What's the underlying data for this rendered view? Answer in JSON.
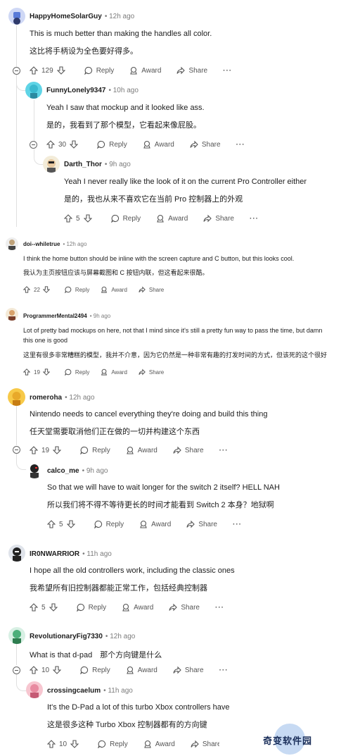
{
  "comments": [
    {
      "user": "HappyHomeSolarGuy",
      "time": "12h ago",
      "en": "This is much better than making the handles all color.",
      "zh": "这比将手柄设为全色要好得多。",
      "votes": "129"
    },
    {
      "user": "FunnyLonely9347",
      "time": "10h ago",
      "en": "Yeah I saw that mockup and it looked like ass.",
      "zh": "是的，我看到了那个模型，它看起来像屁股。",
      "votes": "30"
    },
    {
      "user": "Darth_Thor",
      "time": "9h ago",
      "en": "Yeah I never really like the look of it on the current Pro Controller either",
      "zh": "是的，我也从来不喜欢它在当前 Pro 控制器上的外观",
      "votes": "5"
    },
    {
      "user": "doi--whiletrue",
      "time": "12h ago",
      "en": "I think the home button should be inline with the screen capture and C button, but this looks cool.",
      "zh": "我认为主页按钮应该与屏幕截图和 C 按钮内联，但这看起来很酷。",
      "votes": "22"
    },
    {
      "user": "ProgrammerMental2494",
      "time": "9h ago",
      "en": "Lot of pretty bad mockups on here, not that I mind since it's still a pretty fun way to pass the time, but damn",
      "en2": "this one is good",
      "zh": "这里有很多非常糟糕的模型，我并不介意，因为它仍然是一种非常有趣的打发时间的方式，但该死的这个很好",
      "votes": "19"
    },
    {
      "user": "romeroha",
      "time": "12h ago",
      "en": "Nintendo needs to cancel everything they're doing and build this thing",
      "zh": "任天堂需要取消他们正在做的一切并构建这个东西",
      "votes": "19"
    },
    {
      "user": "calco_me",
      "time": "9h ago",
      "en": "So that we will have to wait longer for the switch 2 itself? HELL NAH",
      "zh": "所以我们将不得不等待更长的时间才能看到 Switch 2 本身？地狱啊",
      "votes": "5"
    },
    {
      "user": "IR0NWARRIOR",
      "time": "11h ago",
      "en": "I hope all the old controllers work, including the classic ones",
      "zh": "我希望所有旧控制器都能正常工作，包括经典控制器",
      "votes": "5"
    },
    {
      "user": "RevolutionaryFig7330",
      "time": "12h ago",
      "en": "What is that d-pad　那个方向键是什么",
      "votes": "10"
    },
    {
      "user": "crossingcaelum",
      "time": "11h ago",
      "en": "It's the D-Pad a lot of this turbo Xbox controllers have",
      "zh": "这是很多这种 Turbo Xbox 控制器都有的方向键",
      "votes": "10"
    }
  ],
  "labels": {
    "reply": "Reply",
    "award": "Award",
    "share": "Share",
    "more": "···"
  },
  "watermark": "奇变软件园",
  "icons": {
    "upvote": "arrow-up-icon",
    "downvote": "arrow-down-icon",
    "reply": "speech-bubble-icon",
    "award": "award-icon",
    "share": "share-arrow-icon",
    "collapse": "minus-circle-icon"
  }
}
